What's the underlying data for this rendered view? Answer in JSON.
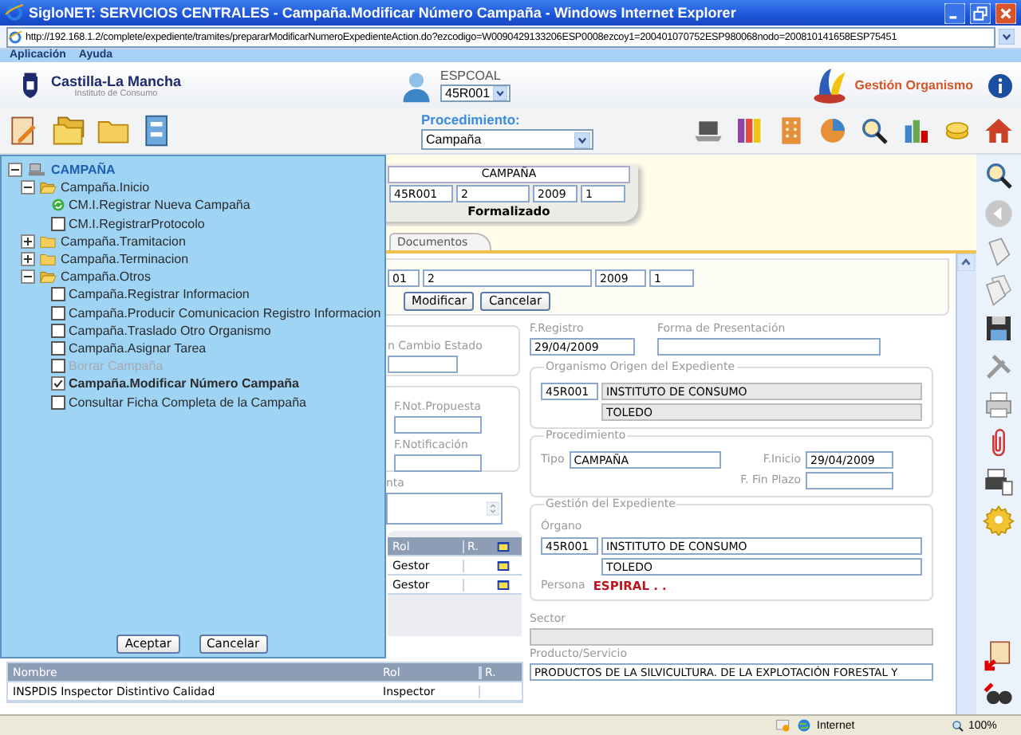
{
  "window": {
    "title": "SigloNET: SERVICIOS CENTRALES - Campaña.Modificar Número Campaña - Windows Internet Explorer"
  },
  "address_bar": {
    "url": "http://192.168.1.2/complete/expediente/tramites/prepararModificarNumeroExpedienteAction.do?ezcodigo=W0090429133206ESP0008ezcoy1=200401070752ESP980068nodo=200810141658ESP75451"
  },
  "menu": [
    "Aplicación",
    "Ayuda"
  ],
  "header": {
    "logo_title": "Castilla-La Mancha",
    "logo_subtitle": "Instituto de Consumo",
    "user": "ESPCOAL",
    "office": "45R001",
    "section": "Gestión Organismo"
  },
  "toolbar": {
    "procedure_label": "Procedimiento:",
    "procedure": "Campaña"
  },
  "tree": {
    "title": "CAMPAÑA",
    "expanded": true,
    "children": [
      {
        "label": "Campaña.Inicio",
        "expanded": true,
        "children": [
          {
            "label": "CM.I.Registrar Nueva Campaña",
            "kind": "done"
          },
          {
            "label": "CM.I.RegistrarProtocolo",
            "kind": "task",
            "checked": false,
            "disabled": false
          }
        ]
      },
      {
        "label": "Campaña.Tramitacion",
        "expanded": false
      },
      {
        "label": "Campaña.Terminacion",
        "expanded": false
      },
      {
        "label": "Campaña.Otros",
        "expanded": true,
        "children": [
          {
            "label": "Campaña.Registrar Informacion",
            "kind": "task",
            "checked": false,
            "disabled": false
          },
          {
            "label": "Campaña.Producir Comunicacion Registro Informacion",
            "kind": "task",
            "checked": false,
            "disabled": false
          },
          {
            "label": "Campaña.Traslado Otro Organismo",
            "kind": "task",
            "checked": false,
            "disabled": false
          },
          {
            "label": "Campaña.Asignar Tarea",
            "kind": "task",
            "checked": false,
            "disabled": false
          },
          {
            "label": "Borrar Campaña",
            "kind": "task",
            "checked": false,
            "disabled": true
          },
          {
            "label": "Campaña.Modificar Número Campaña",
            "kind": "task",
            "checked": true,
            "disabled": false
          },
          {
            "label": "Consultar Ficha Completa de la Campaña",
            "kind": "task",
            "checked": false,
            "disabled": false
          }
        ]
      }
    ]
  },
  "tree_buttons": [
    "Aceptar",
    "Cancelar"
  ],
  "record": {
    "title": "CAMPAÑA",
    "fields": [
      "45R001",
      "2",
      "2009",
      "1"
    ],
    "status": "Formalizado"
  },
  "tabs": [
    {
      "label": "Documentos",
      "selected": false
    }
  ],
  "edit": {
    "fields": [
      "01",
      "2",
      "2009",
      "1"
    ],
    "buttons": [
      "Modificar",
      "Cancelar"
    ]
  },
  "state": {
    "label": "n Cambio Estado"
  },
  "notification": {
    "proposal_label": "F.Not.Propuesta",
    "notification_label": "F.Notificación"
  },
  "notes": {
    "label": "nta"
  },
  "staff_table": {
    "columns": [
      "Rol",
      "R."
    ],
    "rows": [
      {
        "rol": "Gestor"
      },
      {
        "rol": "Gestor"
      }
    ]
  },
  "registro": {
    "label": "F.Registro",
    "value": "29/04/2009"
  },
  "presentacion": {
    "label": "Forma de Presentación"
  },
  "origin": {
    "legend": "Organismo Origen del Expediente",
    "code": "45R001",
    "name": "INSTITUTO DE CONSUMO",
    "city": "TOLEDO"
  },
  "procedure": {
    "legend": "Procedimiento",
    "tipo_label": "Tipo",
    "tipo": "CAMPAÑA",
    "inicio_label": "F.Inicio",
    "inicio": "29/04/2009",
    "fin_label": "F. Fin Plazo"
  },
  "management": {
    "legend": "Gestión del Expediente",
    "organ_label": "Órgano",
    "code": "45R001",
    "name": "INSTITUTO DE CONSUMO",
    "city": "TOLEDO",
    "person_label": "Persona",
    "person": "ESPIRAL . ."
  },
  "sector": {
    "label": "Sector"
  },
  "product": {
    "label": "Producto/Servicio",
    "value": "PRODUCTOS DE LA SILVICULTURA. DE LA EXPLOTACIÓN FORESTAL Y"
  },
  "inspector_table": {
    "columns": [
      "Nombre",
      "Rol",
      "R."
    ],
    "rows": [
      {
        "name": "INSPDIS Inspector Distintivo Calidad",
        "rol": "Inspector"
      }
    ]
  },
  "status_bar": {
    "zone": "Internet",
    "zoom": "100%"
  }
}
